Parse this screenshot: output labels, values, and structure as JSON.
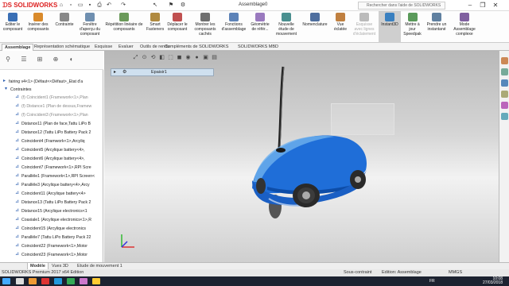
{
  "app": {
    "logo": "SOLIDWORKS",
    "doc_title": "Assemblage0",
    "search_placeholder": "Rechercher dans l'aide de SOLIDWORKS"
  },
  "ribbon": [
    {
      "label": "Editer le composant",
      "color": "#3a6fb5"
    },
    {
      "label": "Insérer des composants",
      "color": "#d98a2b"
    },
    {
      "label": "Contrainte",
      "color": "#888888"
    },
    {
      "label": "Fenêtre d'aperçu du composant",
      "color": "#6f8fb0"
    },
    {
      "label": "Répétition linéaire de composants",
      "color": "#6b9a5a"
    },
    {
      "label": "Smart Fasteners",
      "color": "#b08a40"
    },
    {
      "label": "Déplacer le composant",
      "color": "#c05050"
    },
    {
      "label": "Montrer les composants cachés",
      "color": "#707070"
    },
    {
      "label": "Fonctions d'assemblage",
      "color": "#5d83b8"
    },
    {
      "label": "Géométrie de référ...",
      "color": "#9a7abf"
    },
    {
      "label": "Nouvelle étude de mouvement",
      "color": "#4a8f8f"
    },
    {
      "label": "Nomenclature",
      "color": "#4f6f9f"
    },
    {
      "label": "Vue éclatée",
      "color": "#c08040"
    },
    {
      "label": "Esquisse avec lignes d'éclatement",
      "color": "#bbbbbb",
      "dim": true
    },
    {
      "label": "Instant3D",
      "color": "#3a80c0",
      "selected": true
    },
    {
      "label": "Mettre à jour Speedpak",
      "color": "#5a9a5a"
    },
    {
      "label": "Prendre un instantané",
      "color": "#6080a0"
    },
    {
      "label": "Mode Assemblage complexe",
      "color": "#8060a0"
    }
  ],
  "tabs": [
    "Assemblage",
    "Représentation schématique",
    "Esquisse",
    "Evaluer",
    "Outils de rendu",
    "Compléments de SOLIDWORKS",
    "SOLIDWORKS MBD"
  ],
  "tree": {
    "top": "fairing v4<1> (Défaut<<Défaut>_Etat d'a",
    "contraintes": "Contraintes",
    "items": [
      {
        "text": "(f) Coincident1 (Framework<1>,Plan",
        "dim": true
      },
      {
        "text": "(f) Distance1 (Plan de dessus,Framew",
        "dim": true
      },
      {
        "text": "(f) Coincident3 (Framework<1>,Plan",
        "dim": true
      },
      {
        "text": "Distance11 (Plan de face,Tattu LiPo B"
      },
      {
        "text": "Distance12 (Tattu LiPo Battery Pack 2"
      },
      {
        "text": "Coincident4 (Framwork<1>,Arcyliq"
      },
      {
        "text": "Coincident5 (Arcylique battery<4>,"
      },
      {
        "text": "Coincident6 (Arcylique battery<4>,"
      },
      {
        "text": "Coincident7 (Framework<1>,RPI Scre"
      },
      {
        "text": "Parallèle1 (Framework<1>,RPI Screen<"
      },
      {
        "text": "Parallèle3 (Arcylique battery<4>,Arcy"
      },
      {
        "text": "Coincident11 (Arcylique battery<4>"
      },
      {
        "text": "Distance13 (Tattu LiPo Battery Pack 2"
      },
      {
        "text": "Distance15 (Arcylique electronics<1"
      },
      {
        "text": "Coaxiale1 (Arcylique electronics<1>,R"
      },
      {
        "text": "Coincident15 (Arcylique electronics"
      },
      {
        "text": "Parallèle7 (Tattu LiPo Battery Pack 22"
      },
      {
        "text": "Coincident22 (Framework<1>,Motor"
      },
      {
        "text": "Coincident23 (Framework<1>,Motor"
      }
    ]
  },
  "viewport": {
    "flyout_label": "Epaisir1"
  },
  "bottom_tabs": [
    "Modèle",
    "Vues 3D",
    "Etude de mouvement 1"
  ],
  "status": {
    "edition": "SOLIDWORKS Premium 2017 x64 Edition",
    "constraint": "Sous-contraint",
    "mode": "Edition: Assemblage",
    "units": "MMGS"
  },
  "taskbar": {
    "lang": "FR",
    "time": "10:08",
    "date": "27/03/2018"
  }
}
